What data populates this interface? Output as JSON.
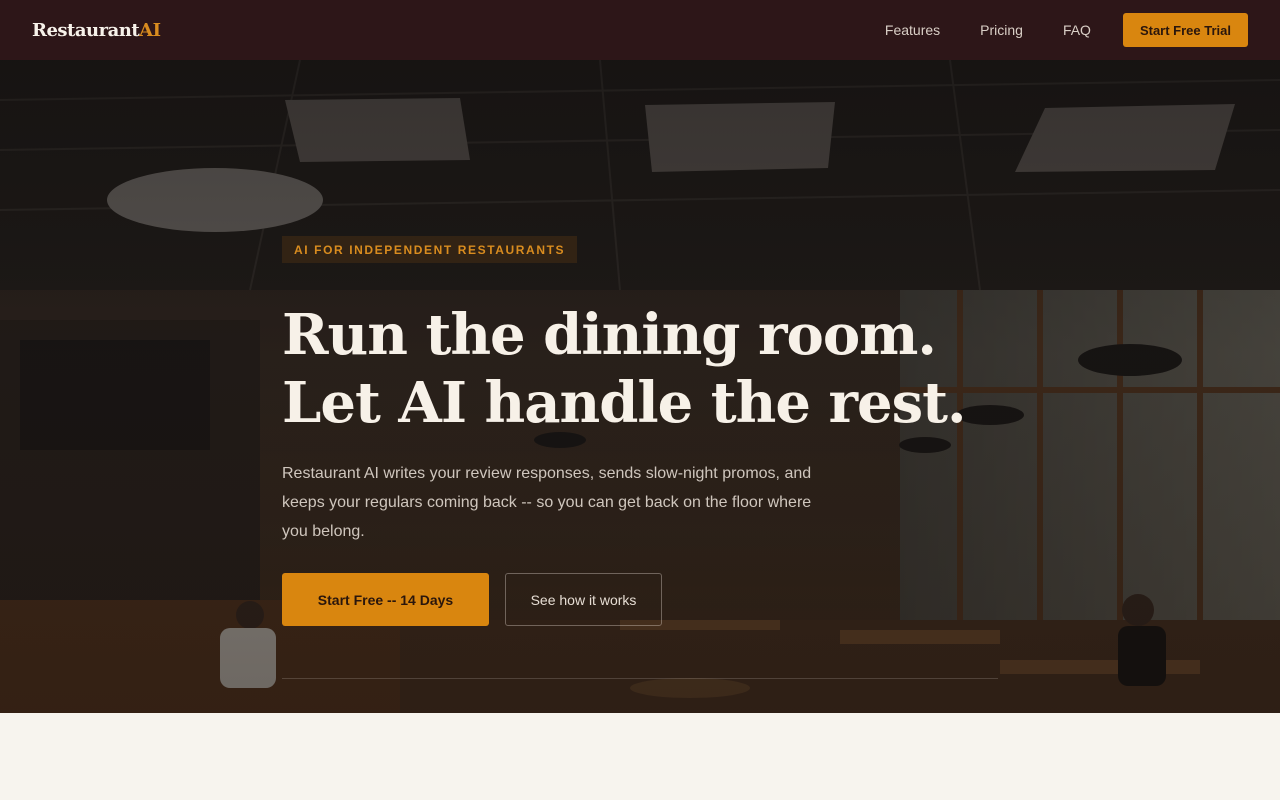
{
  "nav": {
    "logo_main": "Restaurant",
    "logo_accent": "AI",
    "links": [
      "Features",
      "Pricing",
      "FAQ"
    ],
    "cta": "Start Free Trial"
  },
  "hero": {
    "eyebrow": "AI FOR INDEPENDENT RESTAURANTS",
    "headline": "Run the dining room. Let AI handle the rest.",
    "subtext": "Restaurant AI writes your review responses, sends slow-night promos, and keeps your regulars coming back -- so you can get back on the floor where you belong.",
    "primary_cta": "Start Free -- 14 Days",
    "secondary_cta": "See how it works"
  },
  "colors": {
    "nav_bg": "#2d1618",
    "accent": "#d9860f",
    "page_bg": "#f7f4ee"
  }
}
